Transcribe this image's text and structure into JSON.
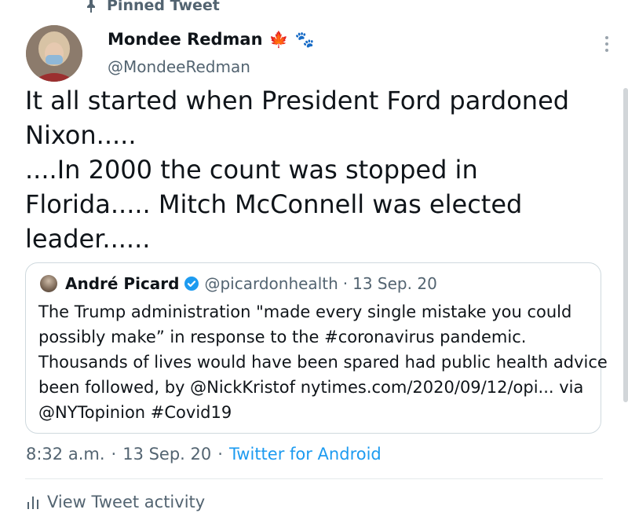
{
  "pinned": {
    "label": "Pinned Tweet",
    "icon": "pin-icon"
  },
  "tweet": {
    "author": {
      "name": "Mondee Redman",
      "flag_emoji": "🍁",
      "paws_emoji": "🐾",
      "handle": "@MondeeRedman"
    },
    "lines": [
      "It all started when President Ford pardoned",
      "Nixon.....",
      "....In 2000 the count was stopped in",
      "Florida..... Mitch McConnell was elected",
      "leader......"
    ],
    "quote": {
      "name": "André Picard",
      "handle": "@picardonhealth",
      "separator": "·",
      "date": "13 Sep. 20",
      "lines": [
        "The Trump administration \"made every single mistake you could",
        "possibly make” in response to the #coronavirus pandemic.",
        "Thousands of lives would have been spared had public health advice",
        "been followed, by @NickKristof  nytimes.com/2020/09/12/opi... via",
        "@NYTopinion #Covid19"
      ]
    },
    "meta": {
      "time": "8:32 a.m.",
      "separator": "·",
      "date": "13 Sep. 20",
      "source": "Twitter for Android"
    },
    "activity_label": "View Tweet activity"
  },
  "colors": {
    "text": "#0f1419",
    "muted": "#536471",
    "link": "#1d9bf0",
    "border": "#cfd9de",
    "verified": "#1d9bf0"
  }
}
